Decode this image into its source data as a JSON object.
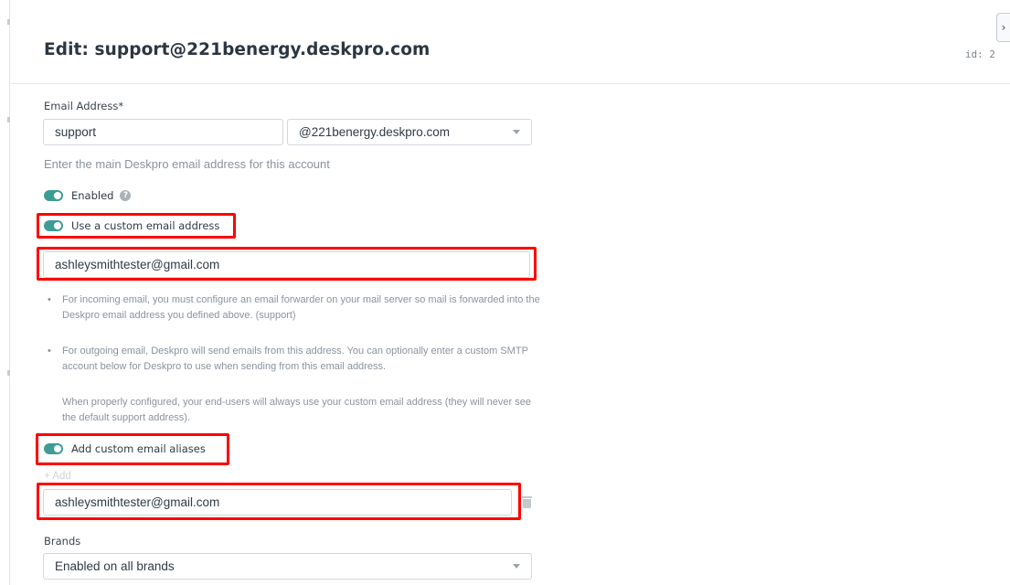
{
  "header": {
    "title": "Edit: support@221benergy.deskpro.com",
    "id_label": "id: 2",
    "collapse_icon": "chevron-right-icon"
  },
  "email_address": {
    "label": "Email Address*",
    "local_part": "support",
    "domain": "@221benergy.deskpro.com",
    "help": "Enter the main Deskpro email address for this account"
  },
  "enabled": {
    "label": "Enabled",
    "on": true,
    "info_icon": "question-circle-icon"
  },
  "custom_email": {
    "label": "Use a custom email address",
    "on": true,
    "value": "ashleysmithtester@gmail.com"
  },
  "notes": [
    {
      "bullet": "•",
      "text": "For incoming email, you must configure an email forwarder on your mail server so mail is forwarded into the Deskpro email address you defined above. (support)"
    },
    {
      "bullet": "•",
      "text": "For outgoing email, Deskpro will send emails from this address. You can optionally enter a custom SMTP account below for Deskpro to use when sending from this email address."
    }
  ],
  "note_extra": "When properly configured, your end-users will always use your custom email address (they will never see the default support address).",
  "aliases": {
    "label": "Add custom email aliases",
    "on": true,
    "add_link": "+ Add",
    "items": [
      "ashleysmithtester@gmail.com"
    ],
    "delete_icon": "trash-icon"
  },
  "brands": {
    "label": "Brands",
    "value": "Enabled on all brands"
  },
  "highlight_color": "#ff0000",
  "toggle_color": "#3d9c94"
}
